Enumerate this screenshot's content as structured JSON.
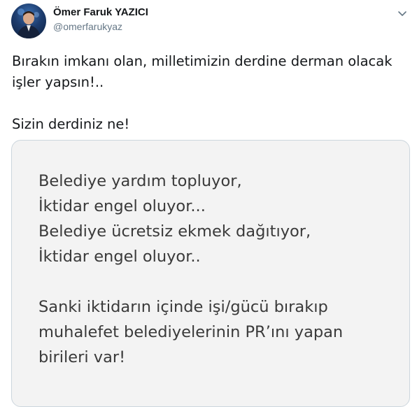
{
  "author": {
    "name": "Ömer Faruk YAZICI",
    "handle": "@omerfarukyaz"
  },
  "icons": {
    "menu": "chevron-down-icon"
  },
  "tweet": {
    "lines": [
      "Bırakın imkanı olan, milletimizin derdine derman olacak",
      "işler yapsın!..",
      "",
      "Sizin derdiniz ne!"
    ]
  },
  "media": {
    "lines": [
      "Belediye yardım topluyor,",
      "İktidar engel oluyor...",
      "Belediye ücretsiz ekmek dağıtıyor,",
      "İktidar engel oluyor..",
      "",
      "Sanki iktidarın içinde işi/gücü bırakıp",
      "muhalefet belediyelerinin PR’ını yapan",
      "birileri var!"
    ]
  },
  "colors": {
    "text": "#14171a",
    "secondary": "#657786",
    "border": "#ccd6dd",
    "media_bg": "#f3f3f3",
    "media_text": "#3a3a3a"
  }
}
